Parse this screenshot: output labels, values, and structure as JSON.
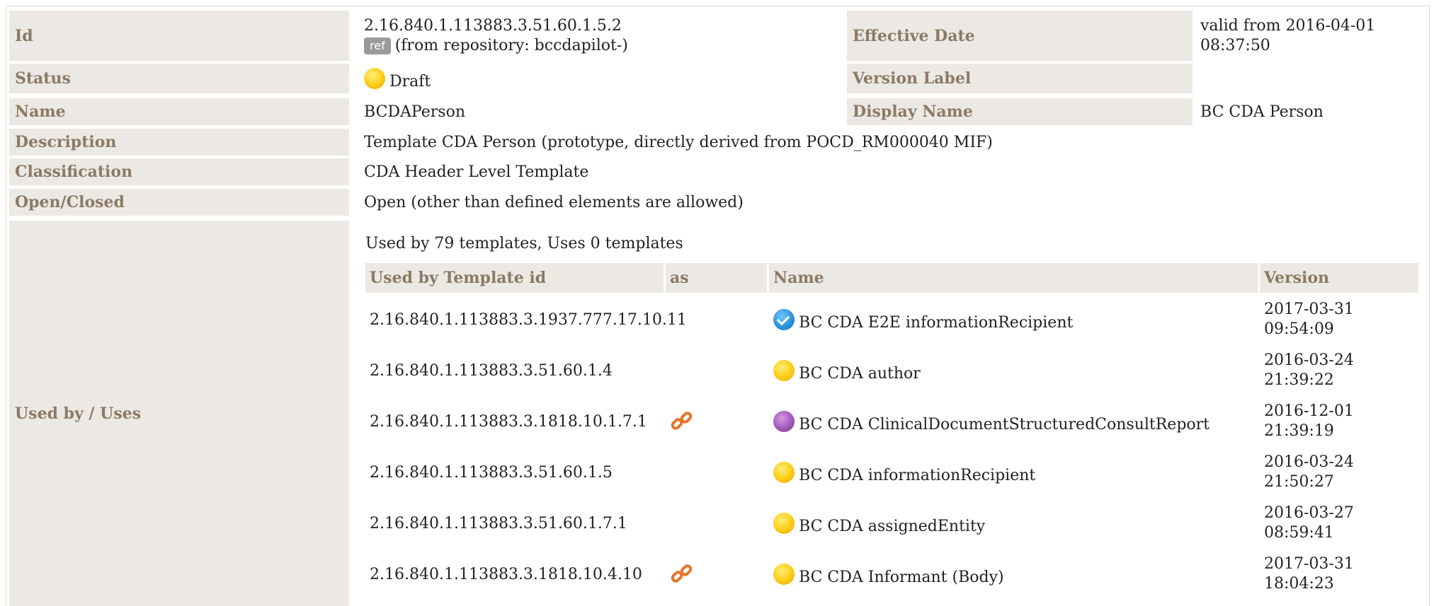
{
  "colors": {
    "label_bg": "#ece8e3",
    "label_text": "#8b7a66",
    "status_draft": "#ffcf1a",
    "status_purple": "#a35cbc",
    "status_active": "#2a8fd8",
    "link_icon": "#e8732a"
  },
  "fields": {
    "id_label": "Id",
    "id_value": "2.16.840.1.113883.3.51.60.1.5.2",
    "ref_badge": "ref",
    "ref_text": "(from repository: bccdapilot-)",
    "effective_label": "Effective Date",
    "effective_value_line1": "valid from 2016-04-01",
    "effective_value_line2": "08:37:50",
    "status_label": "Status",
    "status_value": "Draft",
    "version_label_label": "Version Label",
    "version_label_value": "",
    "name_label": "Name",
    "name_value": "BCDAPerson",
    "display_name_label": "Display Name",
    "display_name_value": "BC CDA Person",
    "description_label": "Description",
    "description_value": "Template CDA Person (prototype, directly derived from POCD_RM000040 MIF)",
    "classification_label": "Classification",
    "classification_value": "CDA Header Level Template",
    "open_closed_label": "Open/Closed",
    "open_closed_value": "Open (other than defined elements are allowed)",
    "used_by_label": "Used by / Uses"
  },
  "used_by": {
    "summary": "Used by 79 templates, Uses 0 templates",
    "headers": {
      "template_id": "Used by Template id",
      "as": "as",
      "name": "Name",
      "version": "Version"
    },
    "rows": [
      {
        "template_id": "2.16.840.1.113883.3.1937.777.17.10.11",
        "as_icon": "",
        "status_icon": "checkmark-blue-icon",
        "name": "BC CDA E2E informationRecipient",
        "version_date": "2017-03-31",
        "version_time": "09:54:09"
      },
      {
        "template_id": "2.16.840.1.113883.3.51.60.1.4",
        "as_icon": "",
        "status_icon": "draft-yellow-icon",
        "name": "BC CDA author",
        "version_date": "2016-03-24",
        "version_time": "21:39:22"
      },
      {
        "template_id": "2.16.840.1.113883.3.1818.10.1.7.1",
        "as_icon": "link-icon",
        "status_icon": "purple-status-icon",
        "name": "BC CDA ClinicalDocumentStructuredConsultReport",
        "version_date": "2016-12-01",
        "version_time": "21:39:19"
      },
      {
        "template_id": "2.16.840.1.113883.3.51.60.1.5",
        "as_icon": "",
        "status_icon": "draft-yellow-icon",
        "name": "BC CDA informationRecipient",
        "version_date": "2016-03-24",
        "version_time": "21:50:27"
      },
      {
        "template_id": "2.16.840.1.113883.3.51.60.1.7.1",
        "as_icon": "",
        "status_icon": "draft-yellow-icon",
        "name": "BC CDA assignedEntity",
        "version_date": "2016-03-27",
        "version_time": "08:59:41"
      },
      {
        "template_id": "2.16.840.1.113883.3.1818.10.4.10",
        "as_icon": "link-icon",
        "status_icon": "draft-yellow-icon",
        "name": "BC CDA Informant (Body)",
        "version_date": "2017-03-31",
        "version_time": "18:04:23"
      }
    ]
  }
}
